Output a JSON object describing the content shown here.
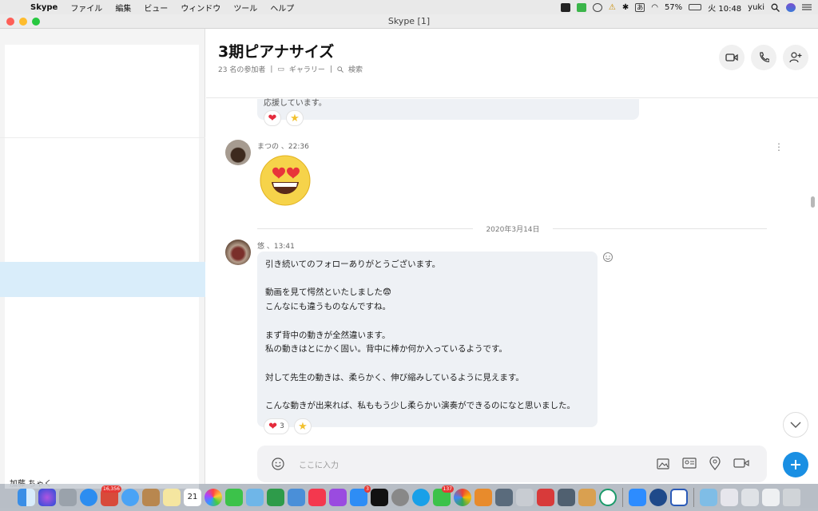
{
  "menubar": {
    "app_name": "Skype",
    "items": [
      "ファイル",
      "編集",
      "ビュー",
      "ウィンドウ",
      "ツール",
      "ヘルプ"
    ],
    "battery": "57%",
    "time": "火 10:48",
    "user": "yuki",
    "ime": "あ"
  },
  "window": {
    "title": "Skype [1]"
  },
  "chat": {
    "title": "3期ピアナサイズ",
    "participants": "23 名の参加者",
    "gallery": "ギャラリー",
    "search": "検索",
    "sep": "|"
  },
  "messages": {
    "top_faded": "応援しています。",
    "m1_meta": "まつの 、22:36",
    "date_separator": "2020年3月14日",
    "m2_meta": "悠 、13:41",
    "m2_text": "引き続いてのフォローありがとうございます。\n\n動画を見て愕然といたしました😨\nこんなにも違うものなんですね。\n\nまず背中の動きが全然違います。\n私の動きはとにかく固い。背中に棒か何か入っているようです。\n\n対して先生の動きは、柔らかく、伸び縮みしているように見えます。\n\nこんな動きが出来れば、私ももう少し柔らかい演奏ができるのになと思いました。",
    "m2_heart_count": "3",
    "more_glyph": "⋮"
  },
  "composer": {
    "placeholder": "ここに入力"
  },
  "sidebar": {
    "partial_contact": "加藤 ちゃく"
  },
  "dock": {
    "badges": {
      "calendar_app": "21",
      "launch_badge": "16,356",
      "line_badge": "137",
      "appstore_badge": "3"
    }
  },
  "colors": {
    "accent": "#1a8fe3",
    "selected_row": "#d9edfa",
    "bubble": "#eef1f5"
  }
}
